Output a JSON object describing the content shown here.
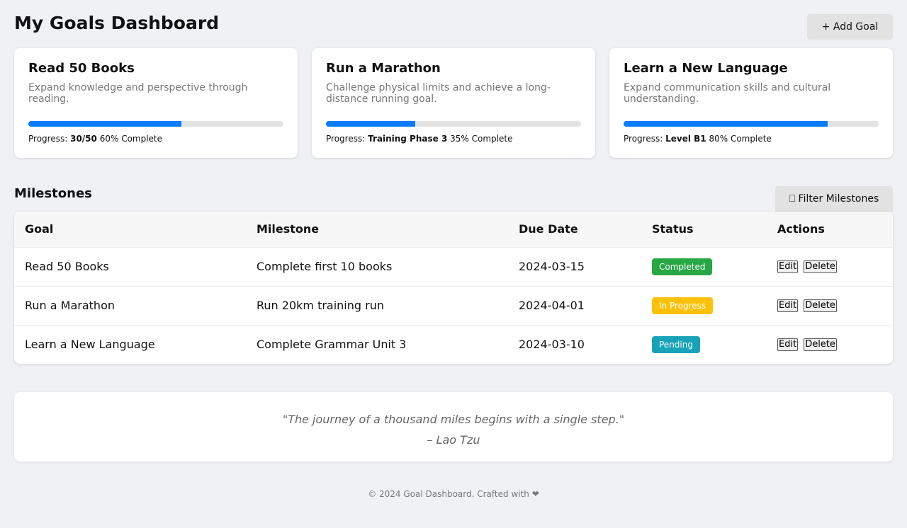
{
  "header": {
    "title": "My Goals Dashboard",
    "add_goal_label": "+ Add Goal"
  },
  "goals": [
    {
      "title": "Read 50 Books",
      "description": "Expand knowledge and perspective through reading.",
      "progress_prefix": "Progress:",
      "progress_value": "30/50",
      "progress_label": "60% Complete",
      "progress_fraction": 0.6
    },
    {
      "title": "Run a Marathon",
      "description": "Challenge physical limits and achieve a long-distance running goal.",
      "progress_prefix": "Progress:",
      "progress_value": "Training Phase 3",
      "progress_label": "35% Complete",
      "progress_fraction": 0.35
    },
    {
      "title": "Learn a New Language",
      "description": "Expand communication skills and cultural understanding.",
      "progress_prefix": "Progress:",
      "progress_value": "Level B1",
      "progress_label": "80% Complete",
      "progress_fraction": 0.8
    }
  ],
  "milestones": {
    "title": "Milestones",
    "filter_label": "⎕ Filter Milestones",
    "columns": [
      "Goal",
      "Milestone",
      "Due Date",
      "Status",
      "Actions"
    ],
    "rows": [
      {
        "goal": "Read 50 Books",
        "milestone": "Complete first 10 books",
        "due": "2024-03-15",
        "status": "Completed",
        "status_color": "#28a745"
      },
      {
        "goal": "Run a Marathon",
        "milestone": "Run 20km training run",
        "due": "2024-04-01",
        "status": "In Progress",
        "status_color": "#ffc107"
      },
      {
        "goal": "Learn a New Language",
        "milestone": "Complete Grammar Unit 3",
        "due": "2024-03-10",
        "status": "Pending",
        "status_color": "#17a2b8"
      }
    ],
    "edit_label": "Edit",
    "delete_label": "Delete"
  },
  "quote": {
    "text": "\"The journey of a thousand miles begins with a single step.\"",
    "author": "– Lao Tzu"
  },
  "footer": {
    "text": "© 2024 Goal Dashboard. Crafted with ❤"
  },
  "colors": {
    "accent": "#0a7cff",
    "background": "#f0f1f5"
  }
}
